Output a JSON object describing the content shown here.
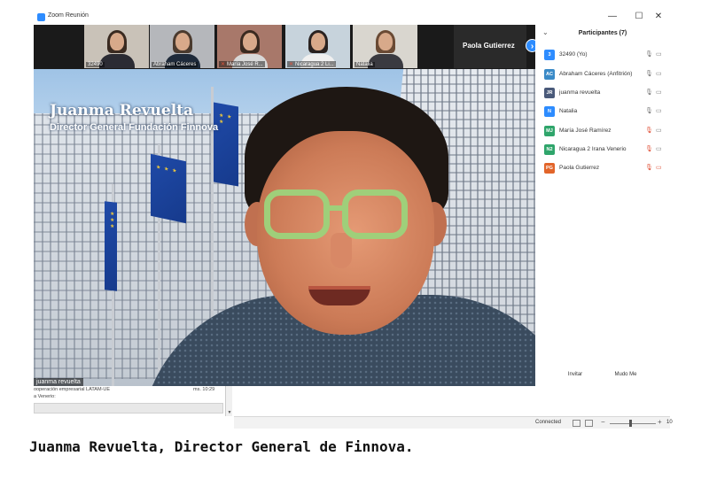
{
  "window": {
    "title": "Zoom Reunión",
    "minimize_glyph": "—",
    "maximize_glyph": "☐",
    "close_glyph": "✕"
  },
  "thumbnails": [
    {
      "name": "32490",
      "muted": false,
      "bg": "#c9c2b8"
    },
    {
      "name": "Abraham Cáceres",
      "muted": false,
      "bg": "#b5b7bb"
    },
    {
      "name": "María José R...",
      "muted": true,
      "bg": "#a8786a"
    },
    {
      "name": "Nicaragua 2 Li...",
      "muted": true,
      "bg": "#c7d3dc"
    },
    {
      "name": "Natalia",
      "muted": false,
      "bg": "#d9d6cf"
    }
  ],
  "active_speaker_tile": {
    "name": "Paola Gutierrez"
  },
  "next_glyph": "›",
  "main_video": {
    "lower_third_name": "Juanma Revuelta",
    "lower_third_title": "Director General Fundación Finnova",
    "label": "juanma revuelta"
  },
  "participants_panel": {
    "title": "Participantes (7)",
    "collapse_glyph": "⌄",
    "participants": [
      {
        "initials": "3",
        "name": "32490 (Yo)",
        "color": "#2d8cff",
        "mic_muted": false,
        "cam_off": false
      },
      {
        "initials": "AC",
        "name": "Abraham Cáceres (Anfitrión)",
        "color": "#3a8ac7",
        "mic_muted": false,
        "cam_off": false
      },
      {
        "initials": "JR",
        "name": "juanma revuelta",
        "color": "#4a5a7a",
        "mic_muted": false,
        "cam_off": false
      },
      {
        "initials": "N",
        "name": "Natalia",
        "color": "#2d8cff",
        "mic_muted": false,
        "cam_off": false
      },
      {
        "initials": "MJ",
        "name": "María José Ramírez",
        "color": "#2fa56b",
        "mic_muted": true,
        "cam_off": false
      },
      {
        "initials": "N2",
        "name": "Nicaragua 2 Irana Venerio",
        "color": "#2fa56b",
        "mic_muted": true,
        "cam_off": false
      },
      {
        "initials": "PG",
        "name": "Paola Gutierrez",
        "color": "#e2652a",
        "mic_muted": true,
        "cam_off": true
      }
    ],
    "invite_label": "Invitar",
    "mute_all_label": "Mudo Me"
  },
  "chat": {
    "line1": "ooperación empresarial LATAM-UE",
    "time": "ms. 10:29",
    "line2": "a Venerio:",
    "scroll_down_glyph": "▼"
  },
  "status_bar": {
    "status": "Connected",
    "zoom_minus": "−",
    "zoom_plus": "+",
    "zoom_level": "10"
  },
  "caption": "Juanma Revuelta, Director General de Finnova."
}
